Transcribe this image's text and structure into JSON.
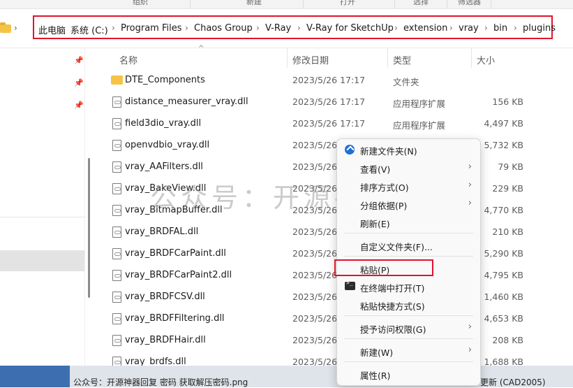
{
  "ribbon": [
    "组织",
    "新建",
    "打开",
    "选择",
    "筛选器"
  ],
  "breadcrumb": [
    "此电脑",
    "系统 (C:)",
    "Program Files",
    "Chaos Group",
    "V-Ray",
    "V-Ray for SketchUp",
    "extension",
    "vray",
    "bin",
    "plugins"
  ],
  "columns": {
    "name": "名称",
    "date": "修改日期",
    "type": "类型",
    "size": "大小"
  },
  "files": [
    {
      "name": "DTE_Components",
      "date": "2023/5/26 17:17",
      "type": "文件夹",
      "size": "",
      "kind": "folder"
    },
    {
      "name": "distance_measurer_vray.dll",
      "date": "2023/5/26 17:17",
      "type": "应用程序扩展",
      "size": "156 KB",
      "kind": "file"
    },
    {
      "name": "field3dio_vray.dll",
      "date": "2023/5/26 17:17",
      "type": "应用程序扩展",
      "size": "4,497 KB",
      "kind": "file"
    },
    {
      "name": "openvdbio_vray.dll",
      "date": "2023/5/26",
      "type": "",
      "size": "5,732 KB",
      "kind": "file"
    },
    {
      "name": "vray_AAFilters.dll",
      "date": "2023/5/26",
      "type": "",
      "size": "79 KB",
      "kind": "file"
    },
    {
      "name": "vray_BakeView.dll",
      "date": "2023/5/26",
      "type": "",
      "size": "229 KB",
      "kind": "file"
    },
    {
      "name": "vray_BitmapBuffer.dll",
      "date": "2023/5/26",
      "type": "",
      "size": "4,770 KB",
      "kind": "file"
    },
    {
      "name": "vray_BRDFAL.dll",
      "date": "2023/5/26",
      "type": "",
      "size": "210 KB",
      "kind": "file"
    },
    {
      "name": "vray_BRDFCarPaint.dll",
      "date": "2023/5/26",
      "type": "",
      "size": "5,290 KB",
      "kind": "file"
    },
    {
      "name": "vray_BRDFCarPaint2.dll",
      "date": "2023/5/26",
      "type": "",
      "size": "4,795 KB",
      "kind": "file"
    },
    {
      "name": "vray_BRDFCSV.dll",
      "date": "2023/5/26",
      "type": "",
      "size": "1,460 KB",
      "kind": "file"
    },
    {
      "name": "vray_BRDFFiltering.dll",
      "date": "2023/5/26",
      "type": "",
      "size": "4,653 KB",
      "kind": "file"
    },
    {
      "name": "vray_BRDFHair.dll",
      "date": "2023/5/26",
      "type": "",
      "size": "208 KB",
      "kind": "file"
    },
    {
      "name": "vray_brdfs.dll",
      "date": "2023/5/26",
      "type": "",
      "size": "1,688 KB",
      "kind": "file"
    }
  ],
  "context_menu": {
    "new_folder": "新建文件夹(N)",
    "view": "查看(V)",
    "sort": "排序方式(O)",
    "group": "分组依据(P)",
    "refresh": "刷新(E)",
    "customize": "自定义文件夹(F)...",
    "paste": "粘贴(P)",
    "open_terminal": "在终端中打开(T)",
    "paste_shortcut": "粘贴快捷方式(S)",
    "grant_access": "授予访问权限(G)",
    "new": "新建(W)",
    "properties": "属性(R)"
  },
  "watermark": "公众号：开源神器",
  "taskbar": {
    "left": "公众号：开源神器回复 密码 获取解压密码.png",
    "right": "更新 (CAD2005)"
  },
  "colors": {
    "highlight_red": "#e0142a",
    "folder_yellow": "#f5c345",
    "accent_blue": "#1f6fd6"
  }
}
